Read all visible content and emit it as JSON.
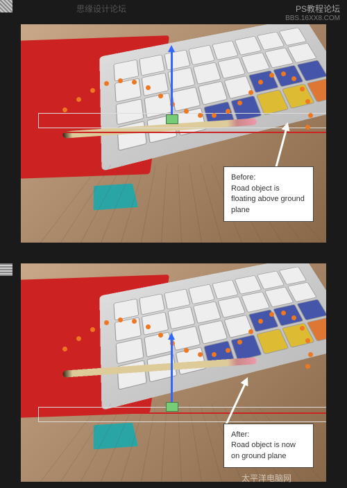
{
  "watermarks": {
    "top_right": "PS教程论坛",
    "top_right_sub": "BBS.16XX8.COM",
    "top_left": "思缘设计论坛",
    "bottom": "太平洋电脑网"
  },
  "panels": {
    "before": {
      "annotation_title": "Before:",
      "annotation_text": "Road object is floating above ground plane"
    },
    "after": {
      "annotation_title": "After:",
      "annotation_text": "Road object is now on ground plane"
    }
  },
  "icons": {
    "gizmo_y_axis": "y-axis-arrow",
    "gizmo_center": "move-gizmo-center",
    "annotation_arrow": "callout-arrow"
  }
}
